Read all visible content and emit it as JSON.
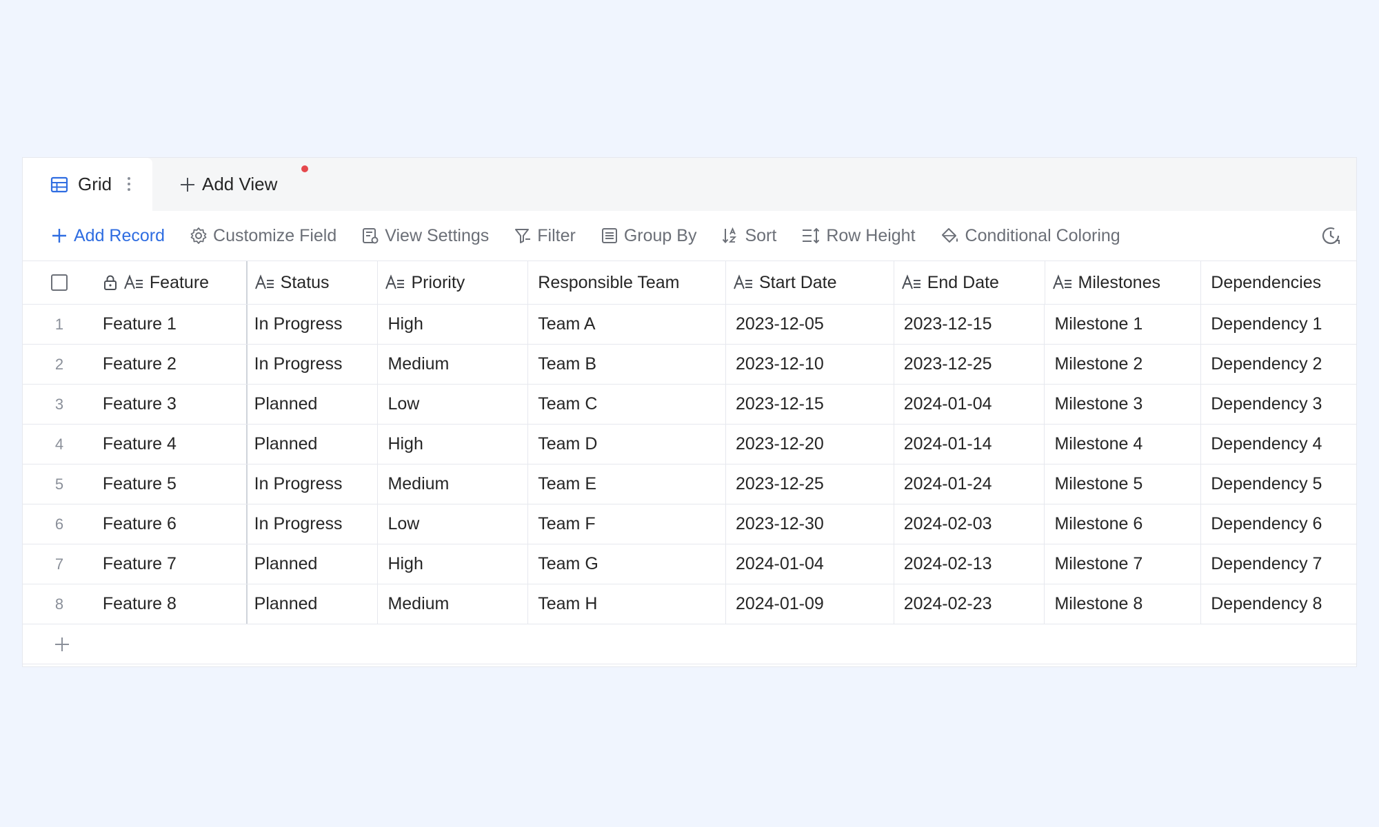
{
  "tabs": {
    "active": {
      "label": "Grid",
      "icon": "grid-table-icon"
    },
    "add_view": {
      "label": "Add View",
      "icon": "plus-icon"
    }
  },
  "colors": {
    "accent": "#2f6de1",
    "notification_dot": "#e5484d",
    "background": "#f0f5fe"
  },
  "toolbar": {
    "add_record": "Add Record",
    "customize_field": "Customize Field",
    "view_settings": "View Settings",
    "filter": "Filter",
    "group_by": "Group By",
    "sort": "Sort",
    "row_height": "Row Height",
    "conditional_coloring": "Conditional Coloring"
  },
  "grid": {
    "columns": {
      "feature": "Feature",
      "status": "Status",
      "priority": "Priority",
      "team": "Responsible Team",
      "start": "Start Date",
      "end": "End Date",
      "milestones": "Milestones",
      "dependencies": "Dependencies"
    },
    "rows": [
      {
        "idx": "1",
        "feature": "Feature 1",
        "status": "In Progress",
        "priority": "High",
        "team": "Team A",
        "start": "2023-12-05",
        "end": "2023-12-15",
        "milestone": "Milestone 1",
        "dependency": "Dependency 1"
      },
      {
        "idx": "2",
        "feature": "Feature 2",
        "status": "In Progress",
        "priority": "Medium",
        "team": "Team B",
        "start": "2023-12-10",
        "end": "2023-12-25",
        "milestone": "Milestone 2",
        "dependency": "Dependency 2"
      },
      {
        "idx": "3",
        "feature": "Feature 3",
        "status": "Planned",
        "priority": "Low",
        "team": "Team C",
        "start": "2023-12-15",
        "end": "2024-01-04",
        "milestone": "Milestone 3",
        "dependency": "Dependency 3"
      },
      {
        "idx": "4",
        "feature": "Feature 4",
        "status": "Planned",
        "priority": "High",
        "team": "Team D",
        "start": "2023-12-20",
        "end": "2024-01-14",
        "milestone": "Milestone 4",
        "dependency": "Dependency 4"
      },
      {
        "idx": "5",
        "feature": "Feature 5",
        "status": "In Progress",
        "priority": "Medium",
        "team": "Team E",
        "start": "2023-12-25",
        "end": "2024-01-24",
        "milestone": "Milestone 5",
        "dependency": "Dependency 5"
      },
      {
        "idx": "6",
        "feature": "Feature 6",
        "status": "In Progress",
        "priority": "Low",
        "team": "Team F",
        "start": "2023-12-30",
        "end": "2024-02-03",
        "milestone": "Milestone 6",
        "dependency": "Dependency 6"
      },
      {
        "idx": "7",
        "feature": "Feature 7",
        "status": "Planned",
        "priority": "High",
        "team": "Team G",
        "start": "2024-01-04",
        "end": "2024-02-13",
        "milestone": "Milestone 7",
        "dependency": "Dependency 7"
      },
      {
        "idx": "8",
        "feature": "Feature 8",
        "status": "Planned",
        "priority": "Medium",
        "team": "Team H",
        "start": "2024-01-09",
        "end": "2024-02-23",
        "milestone": "Milestone 8",
        "dependency": "Dependency 8"
      }
    ]
  }
}
